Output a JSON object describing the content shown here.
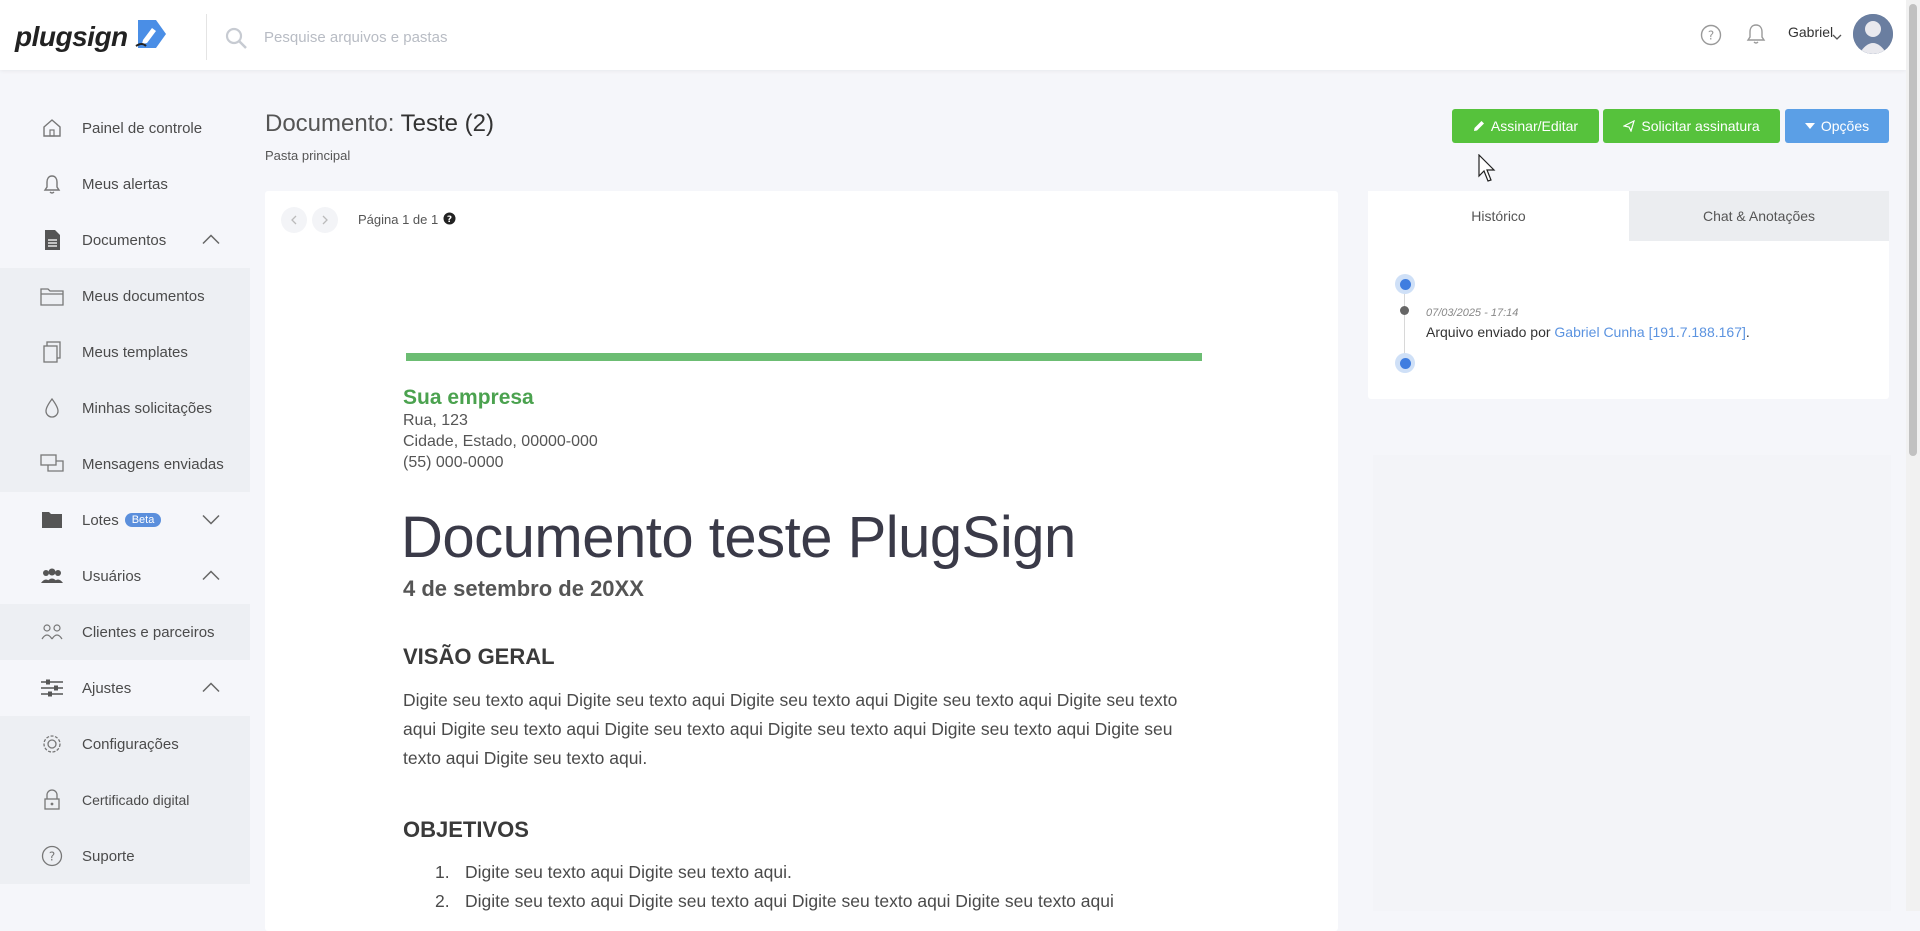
{
  "app": {
    "logo_text": "plugsign",
    "search_placeholder": "Pesquise arquivos e pastas",
    "user_name": "Gabriel"
  },
  "sidebar": {
    "items": [
      {
        "label": "Painel de controle",
        "icon": "home-icon"
      },
      {
        "label": "Meus alertas",
        "icon": "bell-icon"
      },
      {
        "label": "Documentos",
        "icon": "document-icon",
        "expanded": true
      },
      {
        "label": "Meus documentos",
        "icon": "folder-icon"
      },
      {
        "label": "Meus templates",
        "icon": "templates-icon"
      },
      {
        "label": "Minhas solicitações",
        "icon": "drop-icon"
      },
      {
        "label": "Mensagens enviadas",
        "icon": "messages-icon"
      },
      {
        "label": "Lotes",
        "icon": "folder-filled-icon",
        "badge": "Beta",
        "expanded": false
      },
      {
        "label": "Usuários",
        "icon": "users-icon",
        "expanded": true
      },
      {
        "label": "Clientes e parceiros",
        "icon": "clients-icon"
      },
      {
        "label": "Ajustes",
        "icon": "sliders-icon",
        "expanded": true
      },
      {
        "label": "Configurações",
        "icon": "gear-icon"
      },
      {
        "label": "Certificado digital",
        "icon": "lock-icon"
      },
      {
        "label": "Suporte",
        "icon": "help-icon"
      }
    ]
  },
  "header": {
    "title_prefix": "Documento:",
    "title_name": "Teste (2)",
    "breadcrumb": "Pasta principal",
    "btn_sign": "Assinar/Editar",
    "btn_request": "Solicitar assinatura",
    "btn_options": "Opções"
  },
  "viewer": {
    "page_text": "Página 1 de 1"
  },
  "document": {
    "company": "Sua empresa",
    "address_line1": "Rua, 123",
    "address_line2": "Cidade, Estado, 00000-000",
    "address_line3": "(55) 000-0000",
    "title": "Documento teste PlugSign",
    "date": "4 de setembro de 20XX",
    "section1_heading": "VISÃO GERAL",
    "section1_text": "Digite seu texto aqui Digite seu texto aqui Digite seu texto aqui Digite seu texto aqui Digite seu texto aqui Digite seu texto aqui Digite seu texto aqui Digite seu texto aqui Digite seu texto aqui Digite seu texto aqui Digite seu texto aqui.",
    "section2_heading": "OBJETIVOS",
    "list": [
      {
        "num": "1.",
        "text": "Digite seu texto aqui Digite seu texto aqui."
      },
      {
        "num": "2.",
        "text": "Digite seu texto aqui Digite seu texto aqui Digite seu texto aqui Digite seu texto aqui"
      }
    ]
  },
  "history": {
    "tab_history": "Histórico",
    "tab_chat": "Chat & Anotações",
    "event_time": "07/03/2025 - 17:14",
    "event_text": "Arquivo enviado por ",
    "event_user": "Gabriel Cunha [191.7.188.167]",
    "event_suffix": "."
  },
  "colors": {
    "green_button": "#56c23c",
    "blue_button": "#5b9fe6",
    "company_green": "#4ba24f",
    "rule_green": "#6cbd73",
    "timeline_blue": "#3f7de0"
  }
}
